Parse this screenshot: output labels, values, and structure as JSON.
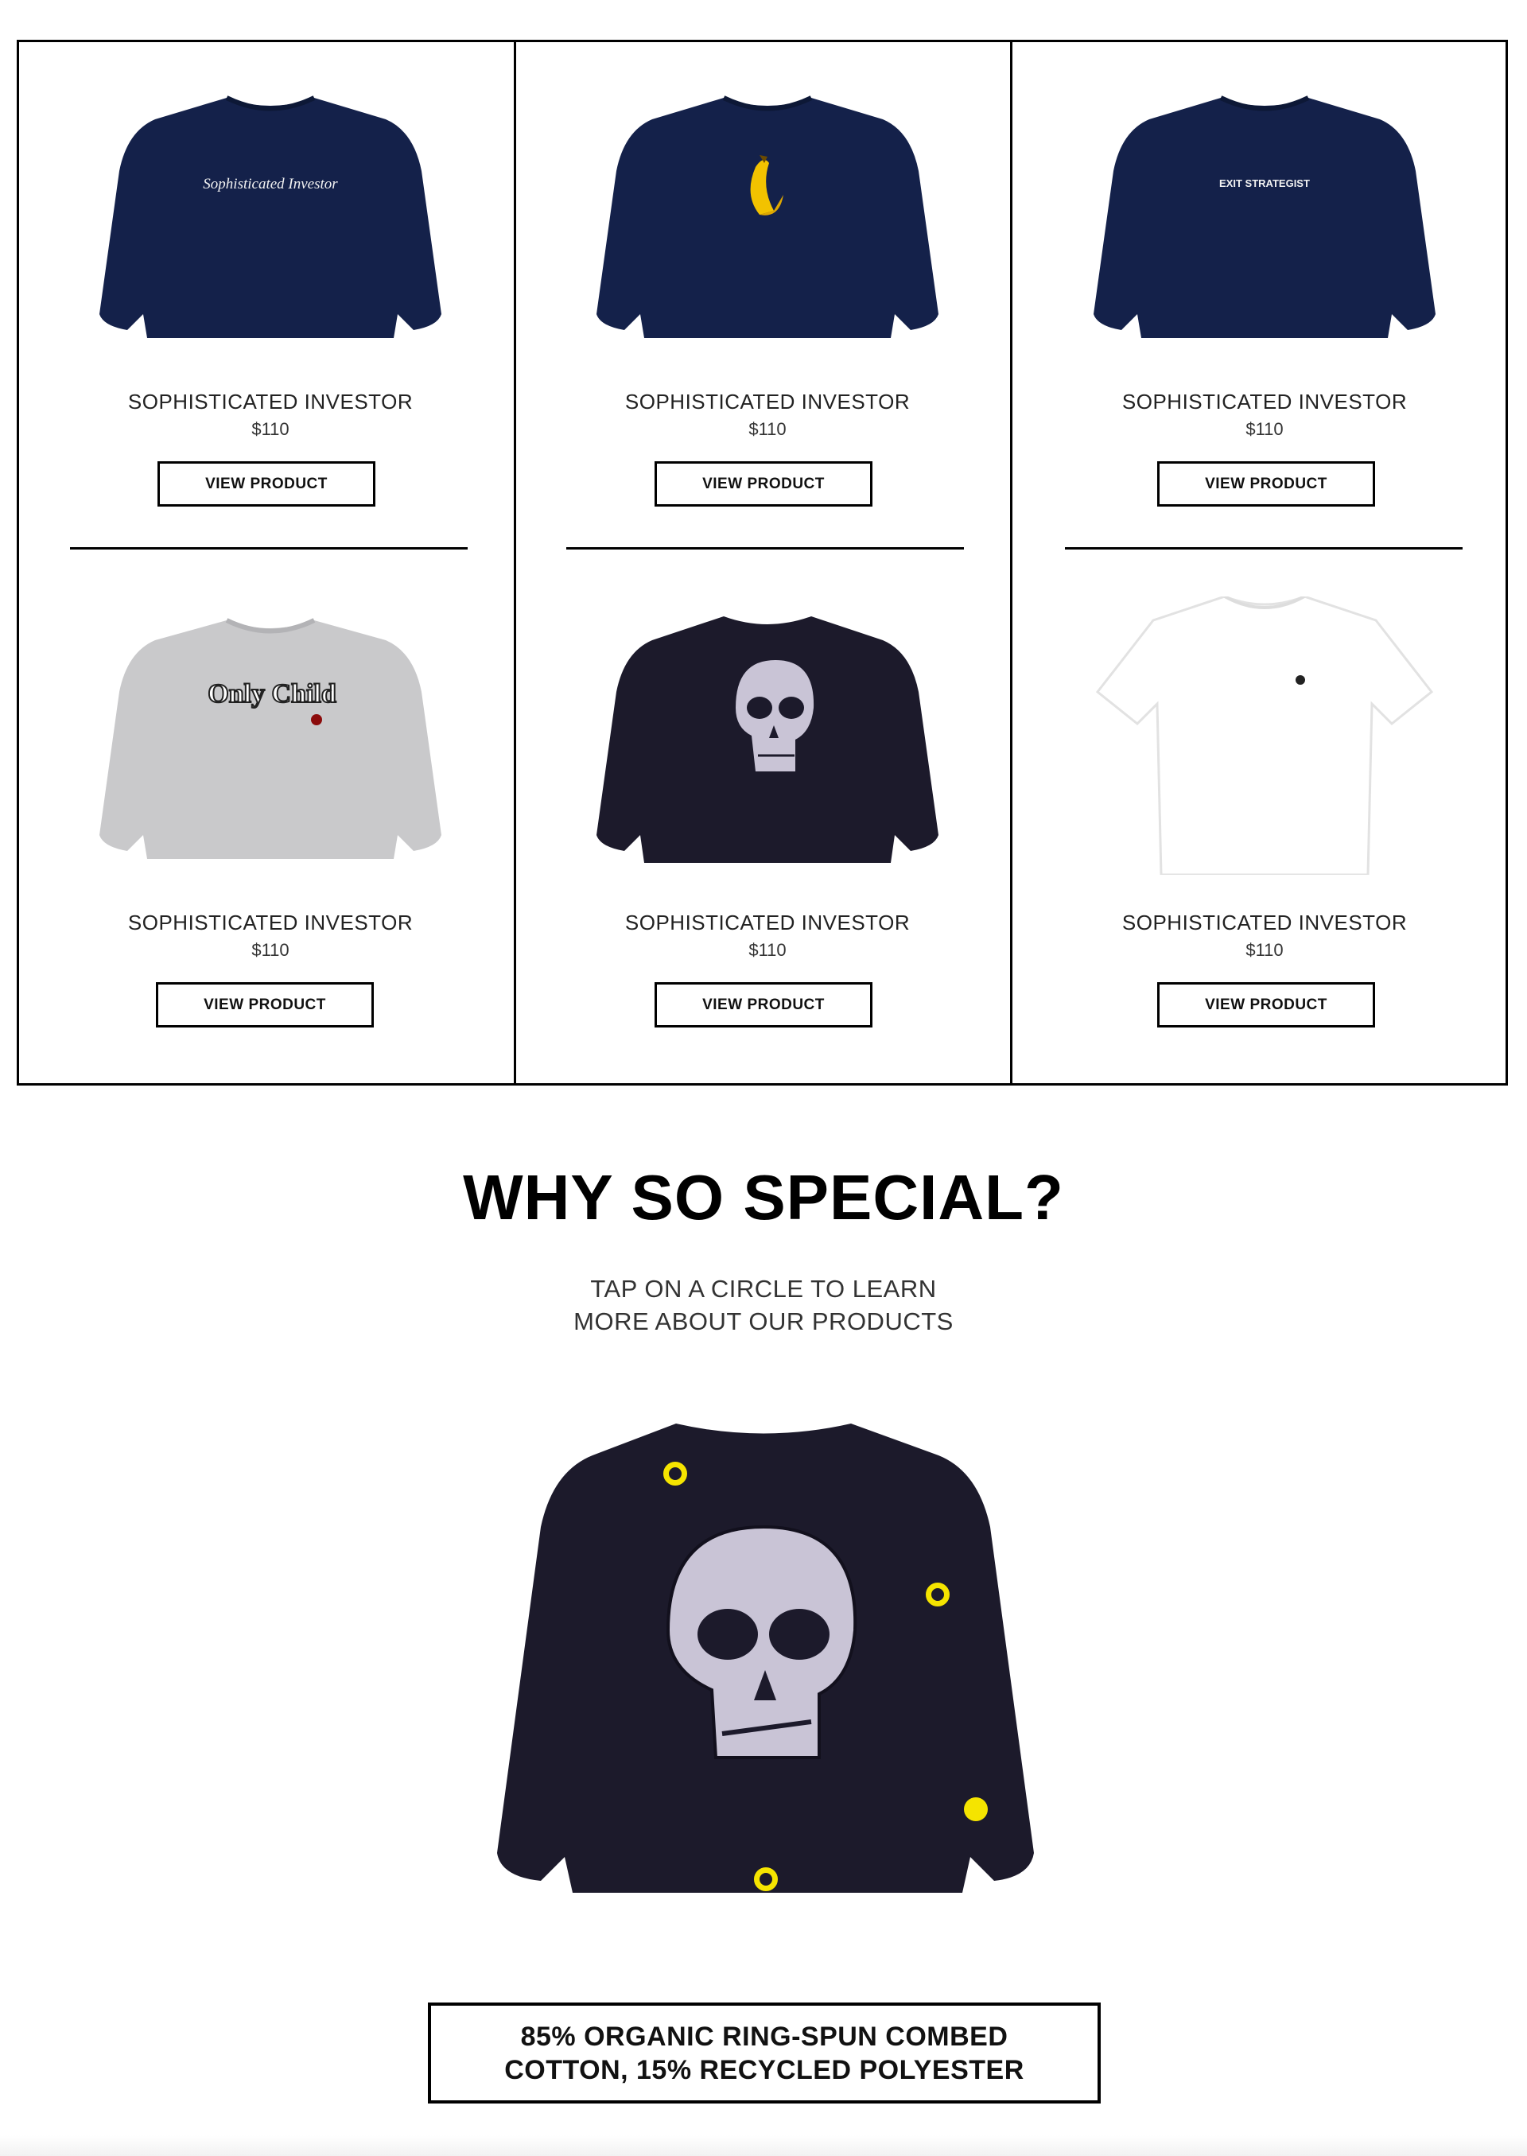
{
  "products": [
    {
      "name": "SOPHISTICATED INVESTOR",
      "price": "$110",
      "button": "VIEW PRODUCT",
      "print_text": "Sophisticated Investor",
      "garment": "navy-sweatshirt"
    },
    {
      "name": "SOPHISTICATED INVESTOR",
      "price": "$110",
      "button": "VIEW PRODUCT",
      "print_text": "",
      "garment": "navy-sweatshirt-banana"
    },
    {
      "name": "SOPHISTICATED INVESTOR",
      "price": "$110",
      "button": "VIEW PRODUCT",
      "print_text": "EXIT STRATEGIST",
      "garment": "navy-sweatshirt"
    },
    {
      "name": "SOPHISTICATED INVESTOR",
      "price": "$110",
      "button": "VIEW PRODUCT",
      "print_text": "Only Child",
      "garment": "grey-sweatshirt"
    },
    {
      "name": "SOPHISTICATED INVESTOR",
      "price": "$110",
      "button": "VIEW PRODUCT",
      "print_text": "",
      "garment": "black-sweatshirt-skull"
    },
    {
      "name": "SOPHISTICATED INVESTOR",
      "price": "$110",
      "button": "VIEW PRODUCT",
      "print_text": "",
      "garment": "white-tshirt"
    }
  ],
  "why": {
    "title": "WHY SO SPECIAL?",
    "subtitle_line1": "TAP ON A CIRCLE TO LEARN",
    "subtitle_line2": "MORE ABOUT OUR PRODUCTS",
    "info_line1": "85% ORGANIC RING-SPUN COMBED",
    "info_line2": "COTTON, 15% RECYCLED POLYESTER"
  },
  "colors": {
    "navy": "#14214a",
    "black_garment": "#1c1a2b",
    "grey_garment": "#c9c9cb",
    "hotspot": "#f5e400"
  }
}
